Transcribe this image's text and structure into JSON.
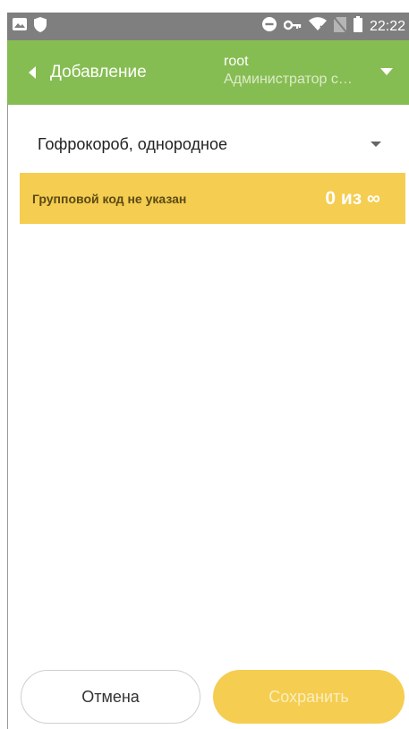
{
  "status_bar": {
    "time": "22:22",
    "icons": [
      "gallery-icon",
      "shield-icon",
      "do-not-disturb-icon",
      "vpn-key-icon",
      "wifi-off-icon",
      "no-sim-icon",
      "battery-icon"
    ]
  },
  "app_bar": {
    "back_label": "Добавление",
    "user_name": "root",
    "user_role": "Администратор с…",
    "bg_color": "#86bd52"
  },
  "form": {
    "type_select_value": "Гофрокороб, однородное",
    "group_status_text": "Групповой код не указан",
    "group_count": "0 из ∞",
    "highlight_color": "#f5cd50"
  },
  "actions": {
    "cancel_label": "Отмена",
    "save_label": "Сохранить"
  }
}
